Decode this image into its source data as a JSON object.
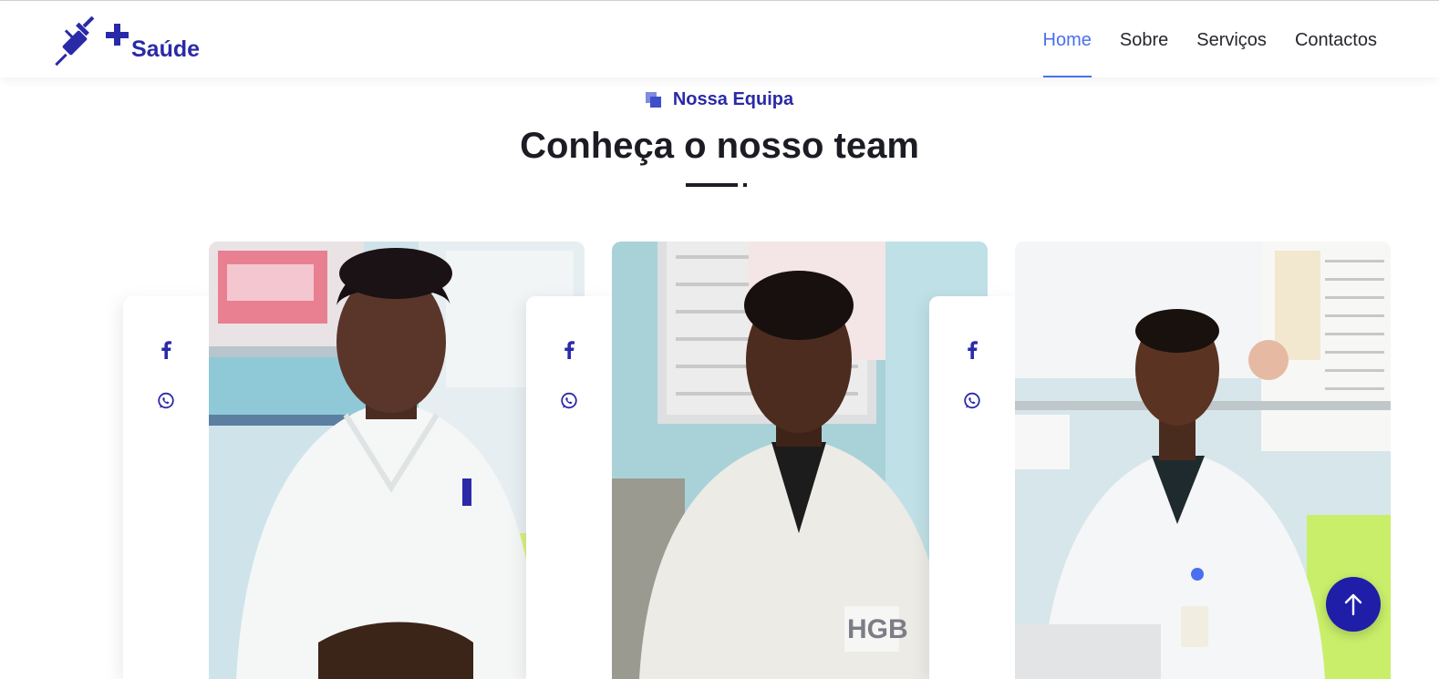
{
  "brand": {
    "name": "Saúde",
    "plus": "+",
    "icon": "syringe-icon",
    "color": "#2a2aa8"
  },
  "nav": {
    "items": [
      {
        "label": "Home",
        "active": true
      },
      {
        "label": "Sobre",
        "active": false
      },
      {
        "label": "Serviços",
        "active": false
      },
      {
        "label": "Contactos",
        "active": false
      }
    ],
    "active_color": "#4a6ff0"
  },
  "section": {
    "eyebrow": "Nossa Equipa",
    "title": "Conheça o nosso team"
  },
  "team": [
    {
      "photo_alt": "Team member 1",
      "socials": [
        "facebook-icon",
        "whatsapp-icon"
      ]
    },
    {
      "photo_alt": "Team member 2",
      "socials": [
        "facebook-icon",
        "whatsapp-icon"
      ]
    },
    {
      "photo_alt": "Team member 3",
      "socials": [
        "facebook-icon",
        "whatsapp-icon"
      ]
    }
  ],
  "back_to_top": {
    "icon": "arrow-up-icon",
    "color": "#1e1ea8"
  }
}
